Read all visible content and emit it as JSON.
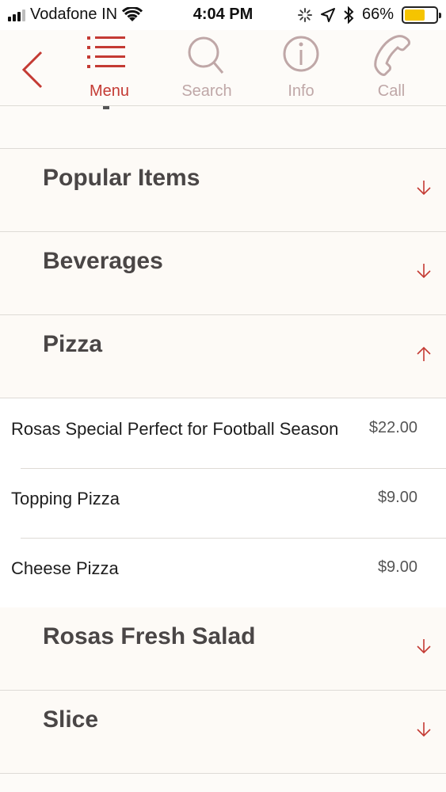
{
  "status_bar": {
    "carrier": "Vodafone IN",
    "time": "4:04 PM",
    "battery_percent": "66%",
    "battery_level": 0.66,
    "battery_color": "#f5c400"
  },
  "nav": {
    "back_icon": "chevron-left-icon",
    "items": [
      {
        "label": "Menu",
        "icon": "menu-list-icon",
        "active": true
      },
      {
        "label": "Search",
        "icon": "search-icon",
        "active": false
      },
      {
        "label": "Info",
        "icon": "info-icon",
        "active": false
      },
      {
        "label": "Call",
        "icon": "phone-icon",
        "active": false
      }
    ],
    "accent_color": "#c43a33",
    "inactive_color": "#bfa7a7"
  },
  "categories": [
    {
      "name": "Popular Items",
      "expanded": false
    },
    {
      "name": "Beverages",
      "expanded": false
    },
    {
      "name": "Pizza",
      "expanded": true,
      "items": [
        {
          "name": "Rosas Special Perfect for Football Season",
          "price": "$22.00"
        },
        {
          "name": "Topping Pizza",
          "price": "$9.00"
        },
        {
          "name": "Cheese Pizza",
          "price": "$9.00"
        }
      ]
    },
    {
      "name": "Rosas Fresh Salad",
      "expanded": false
    },
    {
      "name": "Slice",
      "expanded": false
    }
  ]
}
